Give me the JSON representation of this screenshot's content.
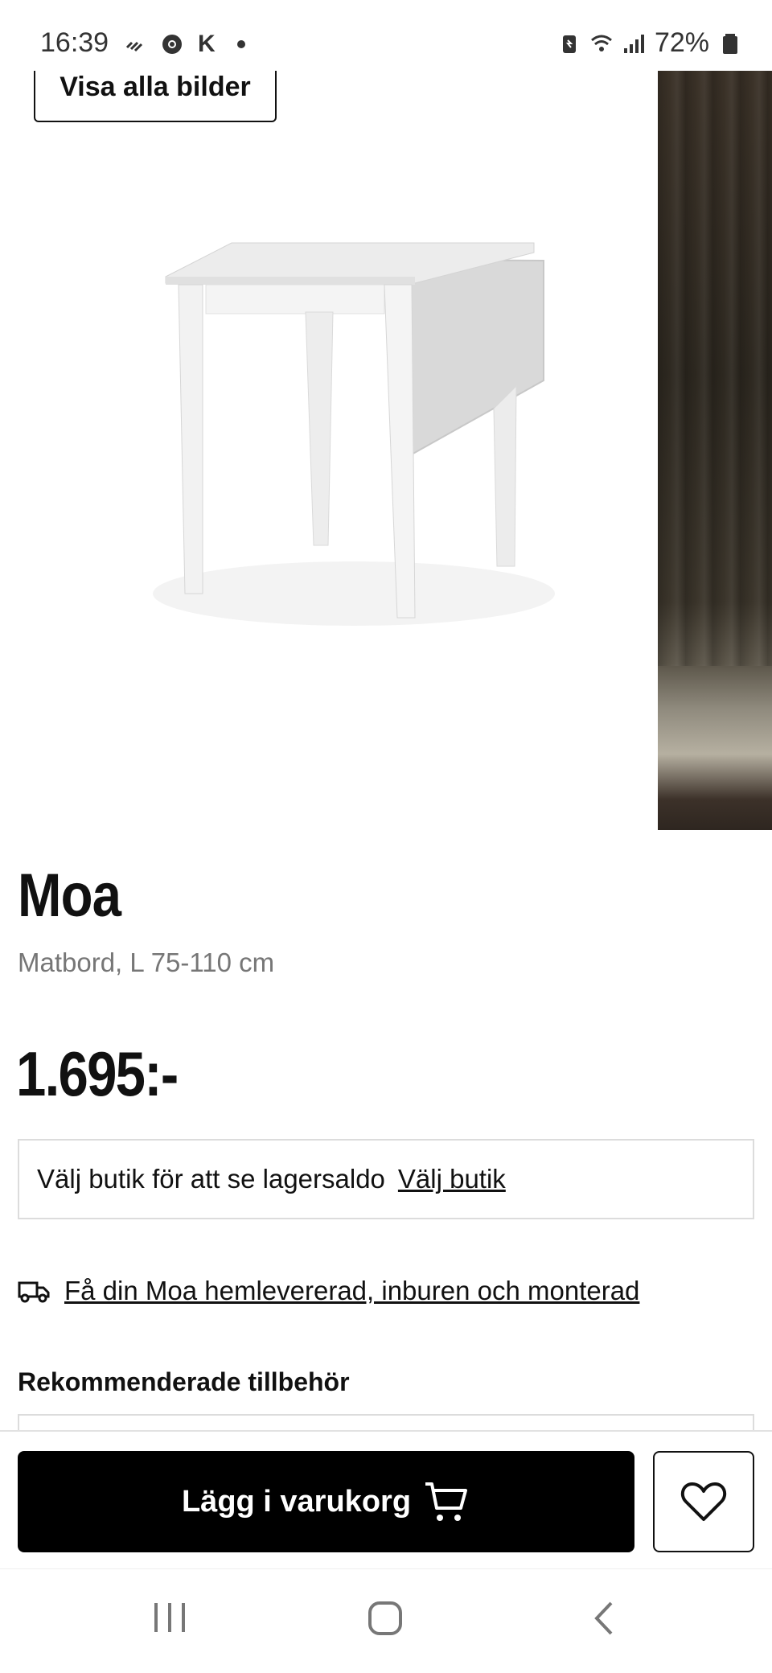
{
  "status_bar": {
    "time": "16:39",
    "notif_k": "K",
    "battery_percent": "72%"
  },
  "gallery": {
    "show_all_label": "Visa alla bilder",
    "main_image_icon": "white-drop-leaf-table",
    "side_image_icon": "dining-room-photo"
  },
  "product": {
    "name": "Moa",
    "description": "Matbord, L 75-110 cm",
    "price": "1.695:-"
  },
  "store": {
    "text": "Välj butik för att se lagersaldo",
    "link": "Välj butik"
  },
  "delivery": {
    "icon": "truck-icon",
    "link": "Få din Moa hemlevererad, inburen och monterad"
  },
  "recommended": {
    "title": "Rekommenderade tillbehör"
  },
  "action_bar": {
    "add_to_cart_label": "Lägg i varukorg",
    "favorite_icon": "heart-icon"
  },
  "colors": {
    "primary_button": "#000000",
    "border": "#dcdcdc",
    "muted_text": "#767676"
  }
}
